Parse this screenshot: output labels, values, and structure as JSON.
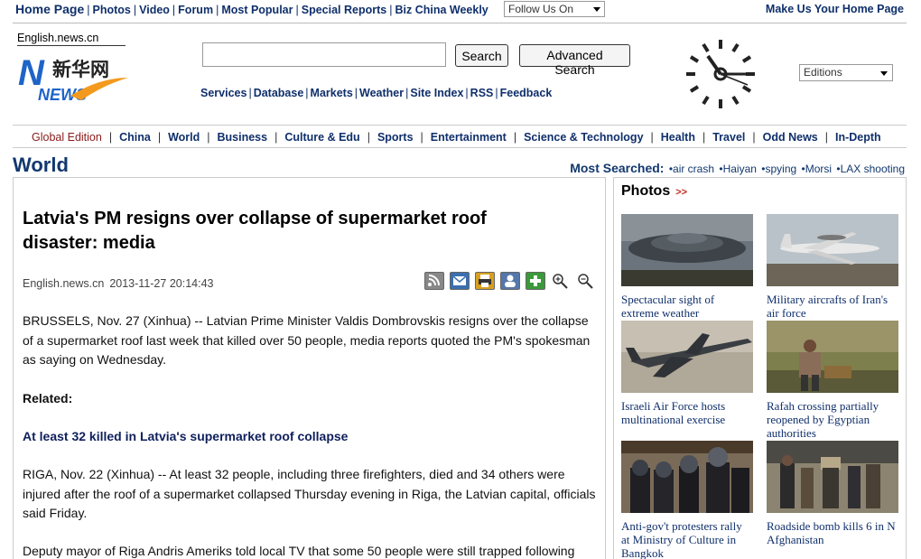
{
  "top": {
    "home": "Home Page",
    "links": [
      "Photos",
      "Video",
      "Forum",
      "Most Popular",
      "Special Reports",
      "Biz China Weekly"
    ],
    "follow_us": "Follow Us On",
    "make_home": "Make Us Your Home Page"
  },
  "header": {
    "site_url": "English.news.cn",
    "logo_cn": "新华网",
    "logo_en": "NEWS",
    "search_button": "Search",
    "advanced_search_button": "Advanced Search",
    "services": [
      "Services",
      "Database",
      "Markets",
      "Weather",
      "Site Index",
      "RSS",
      "Feedback"
    ],
    "editions": "Editions"
  },
  "nav": {
    "global": "Global Edition",
    "items": [
      "China",
      "World",
      "Business",
      "Culture & Edu",
      "Sports",
      "Entertainment",
      "Science & Technology",
      "Health",
      "Travel",
      "Odd News",
      "In-Depth"
    ]
  },
  "section": {
    "title": "World",
    "most_searched_label": "Most Searched:",
    "most_searched": [
      "•air crash",
      "•Haiyan",
      "•spying",
      "•Morsi",
      "•LAX shooting"
    ]
  },
  "article": {
    "headline": "Latvia's PM resigns over collapse of supermarket roof disaster: media",
    "source": "English.news.cn",
    "date": "2013-11-27 20:14:43",
    "p1": "BRUSSELS, Nov. 27 (Xinhua) -- Latvian Prime Minister Valdis Dombrovskis resigns over the collapse of a supermarket roof last week that killed over 50 people, media reports quoted the PM's spokesman as saying on Wednesday.",
    "related_label": "Related:",
    "related_link": "At least 32 killed in Latvia's supermarket roof collapse",
    "p2": "RIGA, Nov. 22 (Xinhua) -- At least 32 people, including three firefighters, died and 34 others were injured after the roof of a supermarket collapsed Thursday evening in Riga, the Latvian capital, officials said Friday.",
    "p3": "Deputy mayor of Riga Andris Ameriks told local TV that some 50 people were still trapped following"
  },
  "photos": {
    "title": "Photos",
    "more": ">>",
    "items": [
      {
        "caption": "Spectacular sight of extreme weather"
      },
      {
        "caption": "Military aircrafts of Iran's air force"
      },
      {
        "caption": "Israeli Air Force hosts multinational exercise"
      },
      {
        "caption": "Rafah crossing partially reopened by Egyptian authorities"
      },
      {
        "caption": "Anti-gov't protesters rally at Ministry of Culture in Bangkok"
      },
      {
        "caption": "Roadside bomb kills 6 in N Afghanistan"
      }
    ]
  }
}
